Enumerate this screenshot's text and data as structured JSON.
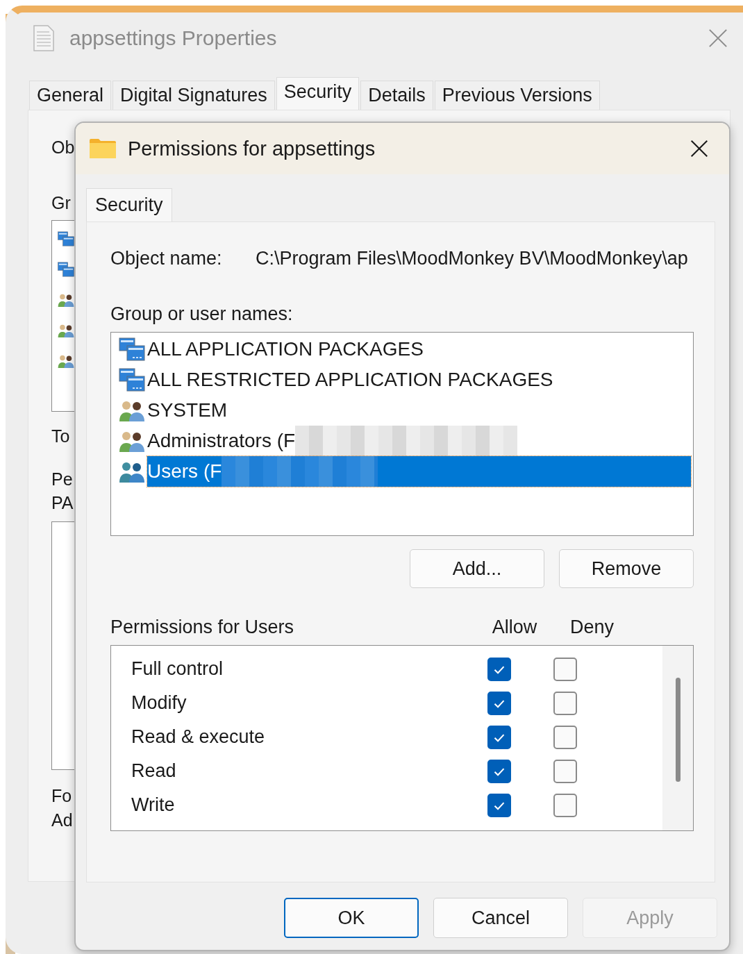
{
  "back_window": {
    "title": "appsettings Properties",
    "tabs": [
      {
        "label": "General",
        "selected": false
      },
      {
        "label": "Digital Signatures",
        "selected": false
      },
      {
        "label": "Security",
        "selected": true
      },
      {
        "label": "Details",
        "selected": false
      },
      {
        "label": "Previous Versions",
        "selected": false
      }
    ],
    "items": [
      {
        "kind": "label",
        "text": "Ob"
      },
      {
        "kind": "label",
        "text": "Gr"
      },
      {
        "kind": "listbox",
        "icons": [
          {
            "kind": "package"
          },
          {
            "kind": "package"
          },
          {
            "kind": "group"
          },
          {
            "kind": "group"
          },
          {
            "kind": "group"
          }
        ]
      },
      {
        "kind": "label",
        "text": "To"
      },
      {
        "kind": "label",
        "text": "Pe"
      },
      {
        "kind": "label",
        "text": "PA"
      },
      {
        "kind": "listbox"
      },
      {
        "kind": "label",
        "text": "Fo"
      },
      {
        "kind": "label",
        "text": "Ad"
      }
    ]
  },
  "dialog": {
    "title": "Permissions for appsettings",
    "tabs": [
      {
        "label": "Security",
        "selected": true
      }
    ],
    "object_name": {
      "label": "Object name:",
      "value": "C:\\Program Files\\MoodMonkey BV\\MoodMonkey\\ap"
    },
    "group_label": {
      "text": "Group or user names:"
    },
    "principals": [
      {
        "kind": "package",
        "name": "ALL APPLICATION PACKAGES",
        "redacted": false,
        "selected": false
      },
      {
        "kind": "package",
        "name": "ALL RESTRICTED APPLICATION PACKAGES",
        "redacted": false,
        "selected": false
      },
      {
        "kind": "group",
        "name": "SYSTEM",
        "redacted": false,
        "selected": false
      },
      {
        "kind": "group",
        "name": "Administrators (F",
        "redacted": true,
        "selected": false
      },
      {
        "kind": "group",
        "name": "Users (F",
        "redacted": true,
        "selected": true
      }
    ],
    "list_buttons": [
      {
        "label": "Add..."
      },
      {
        "label": "Remove"
      }
    ],
    "permissions": {
      "label": {
        "text": "Permissions for Users"
      },
      "columns": [
        "Allow",
        "Deny"
      ],
      "rows": [
        {
          "name": "Full control",
          "allow": true,
          "deny": false
        },
        {
          "name": "Modify",
          "allow": true,
          "deny": false
        },
        {
          "name": "Read & execute",
          "allow": true,
          "deny": false
        },
        {
          "name": "Read",
          "allow": true,
          "deny": false
        },
        {
          "name": "Write",
          "allow": true,
          "deny": false
        }
      ]
    },
    "buttons": [
      {
        "label": "OK",
        "default": true,
        "disabled": false
      },
      {
        "label": "Cancel",
        "default": false,
        "disabled": false
      },
      {
        "label": "Apply",
        "default": false,
        "disabled": true
      }
    ]
  }
}
